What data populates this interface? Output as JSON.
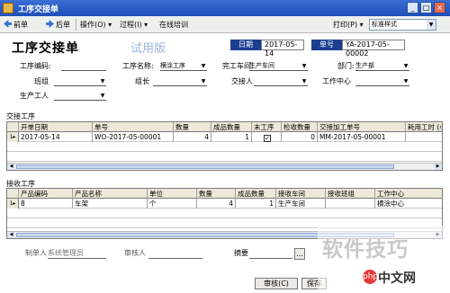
{
  "window": {
    "title": "工序交接单",
    "min": "_",
    "max": "□",
    "close": "×"
  },
  "toolbar": {
    "prev": "前单",
    "next": "后单",
    "operate": "操作(O)",
    "process": "过程(I)",
    "help": "在线培训",
    "print": "打印(P)",
    "style_value": "标准样式"
  },
  "form": {
    "title": "工序交接单",
    "trial": "试用版",
    "date_label": "日期",
    "date_value": "2017-05-14",
    "no_label": "单号",
    "no_value": "YA-2017-05-00002",
    "fields": {
      "process_code": "工序编码:",
      "process_name": "工序名称:",
      "process_name_value": "横涂工序",
      "done_workshop": "完工车间:",
      "done_workshop_value": "生产车间",
      "department": "部门:",
      "department_value": "生产部",
      "team": "班组",
      "group_leader": "组长",
      "handover": "交接人",
      "work_center": "工作中心",
      "worker": "生产工人"
    }
  },
  "handover_section": {
    "title": "交接工序",
    "columns": [
      "开单日期",
      "单号",
      "数量",
      "成品数量",
      "末工序",
      "检收数量",
      "交接加工单号",
      "耗用工时 (小时)"
    ],
    "rows": [
      {
        "mark": "1▸",
        "date": "2017-05-14",
        "no": "WO-2017-05-00001",
        "qty": "4",
        "finished": "1",
        "last": "✓",
        "checked": "0",
        "proc_no": "MM-2017-05-00001",
        "hours": ""
      }
    ]
  },
  "receive_section": {
    "title": "接收工序",
    "columns": [
      "产品编码",
      "产品名称",
      "单位",
      "数量",
      "成品数量",
      "接收车间",
      "接收班组",
      "工作中心"
    ],
    "rows": [
      {
        "mark": "1▸",
        "code": "8",
        "name": "车架",
        "unit": "个",
        "qty": "4",
        "finished": "1",
        "workshop": "生产车间",
        "team": "",
        "center": "横涂中心"
      }
    ]
  },
  "footer": {
    "maker_label": "制单人",
    "maker_value": "系统管理员",
    "reviewer_label": "审核人",
    "summary_label": "摘要",
    "review_btn": "审核(C)",
    "save_btn": "保存"
  },
  "watermark": {
    "text": "软件技巧",
    "logo": "php",
    "site": "中文网"
  }
}
